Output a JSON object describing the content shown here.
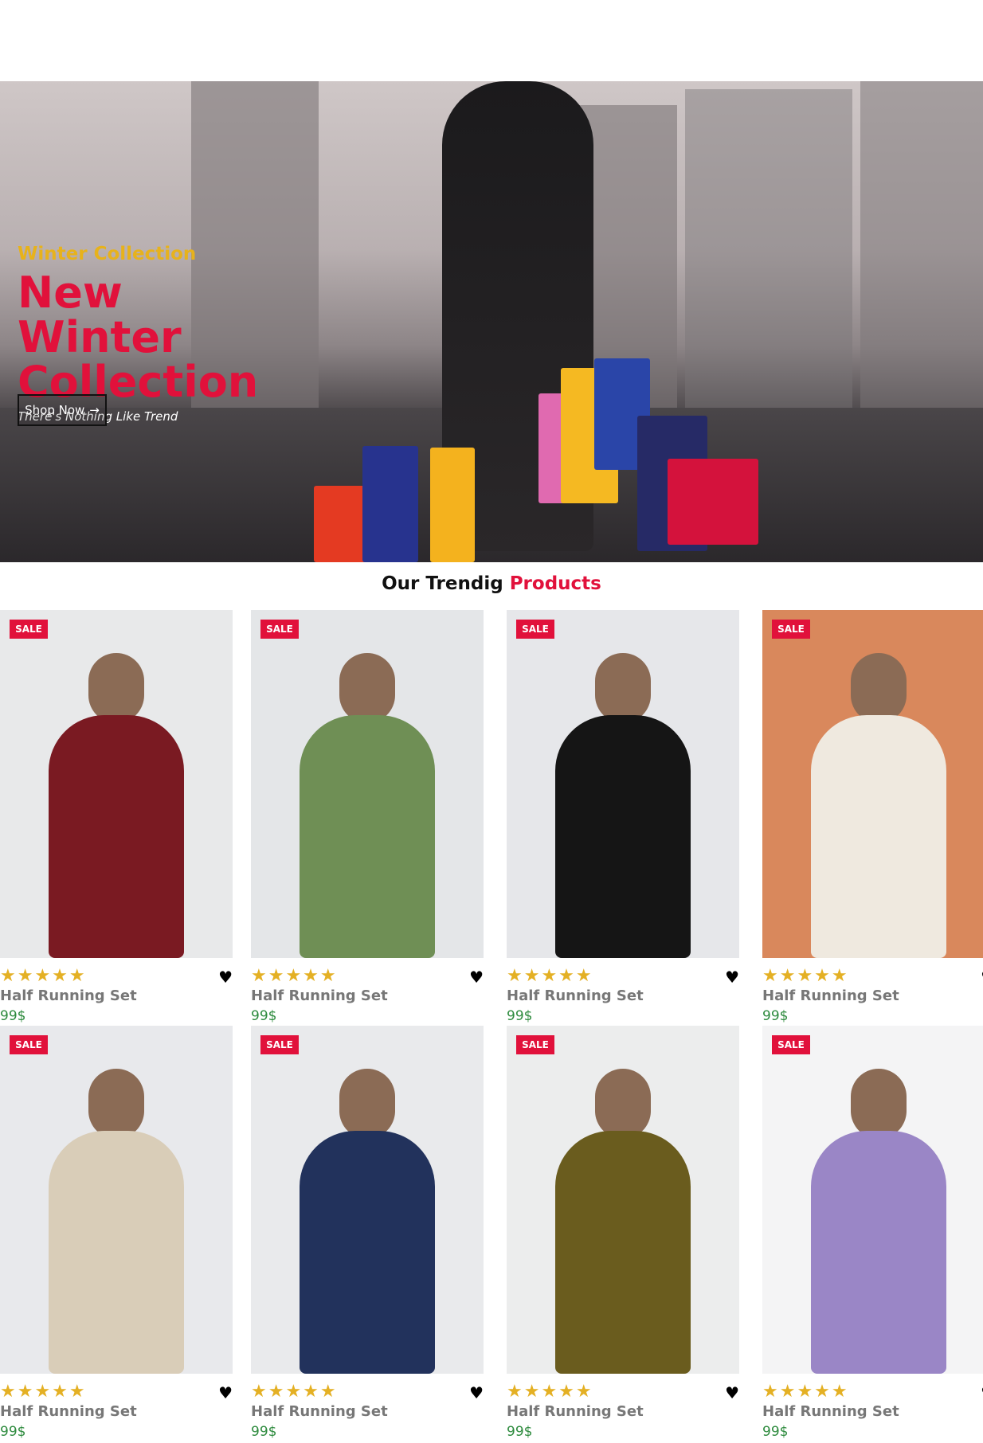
{
  "hero": {
    "eyebrow": "Winter Collection",
    "headline": "New Winter Collection",
    "tagline": "There's Nothing Like Trend",
    "cta_label": "Shop Now",
    "cta_icon": "arrow-right-icon"
  },
  "section": {
    "title_prefix": "Our Trendig",
    "title_accent": "Products"
  },
  "products": [
    {
      "badge": "SALE",
      "name": "Half Running Set",
      "price": "99$",
      "rating": 5,
      "bg": "#e8e9ea",
      "garment": "#7a1a22"
    },
    {
      "badge": "SALE",
      "name": "Half Running Set",
      "price": "99$",
      "rating": 5,
      "bg": "#e4e6e8",
      "garment": "#6f8f55"
    },
    {
      "badge": "SALE",
      "name": "Half Running Set",
      "price": "99$",
      "rating": 5,
      "bg": "#e6e7ea",
      "garment": "#151515"
    },
    {
      "badge": "SALE",
      "name": "Half Running Set",
      "price": "99$",
      "rating": 5,
      "bg": "#d9885c",
      "garment": "#efe9df"
    },
    {
      "badge": "SALE",
      "name": "Half Running Set",
      "price": "99$",
      "rating": 5,
      "bg": "#e8e9ec",
      "garment": "#d9cdb8"
    },
    {
      "badge": "SALE",
      "name": "Half Running Set",
      "price": "99$",
      "rating": 5,
      "bg": "#e9eaec",
      "garment": "#22325c"
    },
    {
      "badge": "SALE",
      "name": "Half Running Set",
      "price": "99$",
      "rating": 5,
      "bg": "#eceded",
      "garment": "#6a5c1e"
    },
    {
      "badge": "SALE",
      "name": "Half Running Set",
      "price": "99$",
      "rating": 5,
      "bg": "#f4f4f5",
      "garment": "#9a86c6"
    }
  ],
  "colors": {
    "accent": "#e1113b",
    "gold": "#e7b21b",
    "price": "#2e8b3e"
  }
}
